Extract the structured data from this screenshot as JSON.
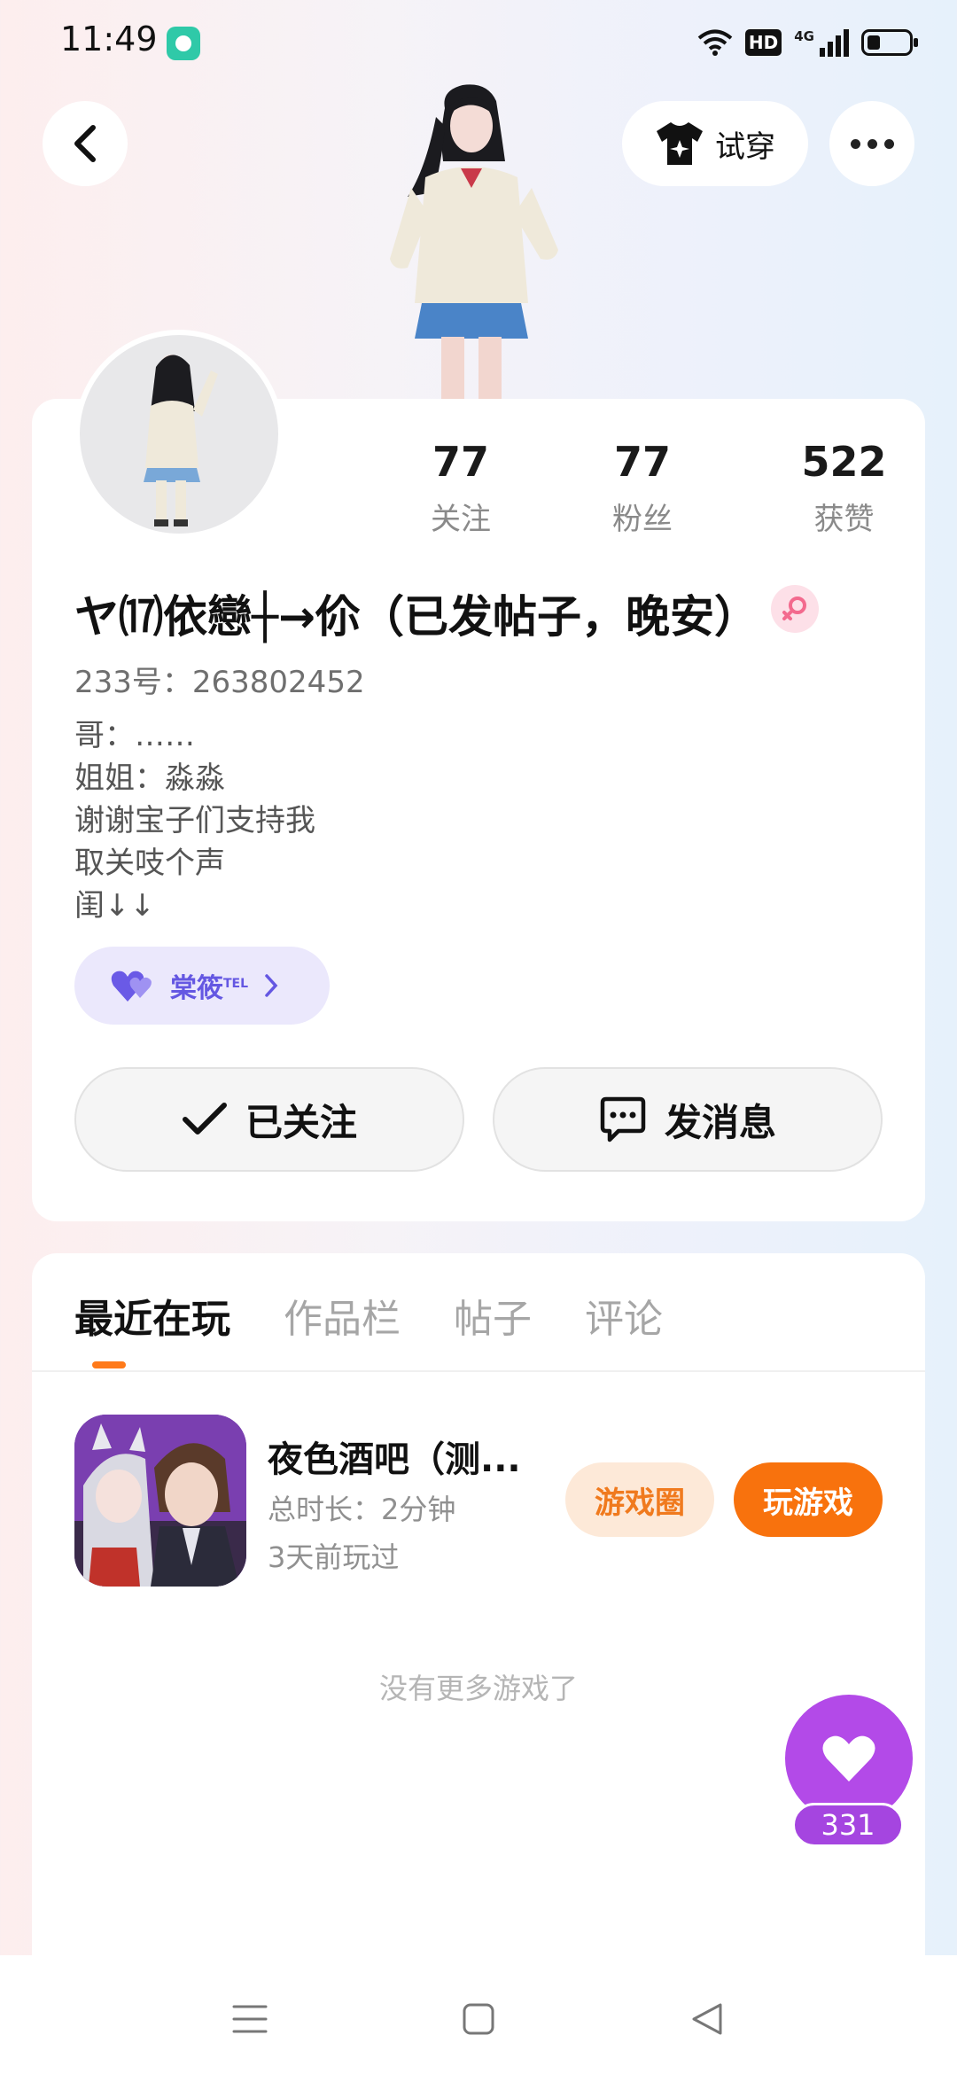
{
  "status_bar": {
    "time": "11:49",
    "network": "4G",
    "hd": "HD",
    "icons": [
      "app-notification-icon",
      "wifi-icon",
      "hd-icon",
      "signal-icon",
      "battery-icon"
    ]
  },
  "header": {
    "back_icon": "chevron-left-icon",
    "tryon_label": "试穿",
    "tryon_icon": "tshirt-sparkle-icon",
    "more_icon": "more-dots-icon"
  },
  "profile": {
    "username": "ヤ⒄依戀┼→伱（已发帖子，晚安）",
    "gender": "female",
    "uid_text": "233号：263802452",
    "stats": [
      {
        "value": "77",
        "label": "关注"
      },
      {
        "value": "77",
        "label": "粉丝"
      },
      {
        "value": "522",
        "label": "获赞"
      }
    ],
    "bio": [
      "哥：……",
      "姐姐：淼淼",
      "谢谢宝子们支持我",
      "取关吱个声",
      "闺↓↓"
    ],
    "cp_tag": {
      "name": "棠筱",
      "sup": "TEL"
    },
    "follow_label": "已关注",
    "message_label": "发消息"
  },
  "tabs": {
    "items": [
      {
        "label": "最近在玩",
        "active": true
      },
      {
        "label": "作品栏",
        "active": false
      },
      {
        "label": "帖子",
        "active": false
      },
      {
        "label": "评论",
        "active": false
      }
    ]
  },
  "recent_games": [
    {
      "title": "夜色酒吧（测...",
      "playtime": "总时长：2分钟",
      "last_played": "3天前玩过",
      "circle_label": "游戏圈",
      "play_label": "玩游戏"
    }
  ],
  "no_more_text": "没有更多游戏了",
  "like": {
    "count": "331"
  },
  "colors": {
    "accent_orange": "#f8720d",
    "purple_like": "#b34ae8",
    "cp_purple": "#6457e2"
  }
}
